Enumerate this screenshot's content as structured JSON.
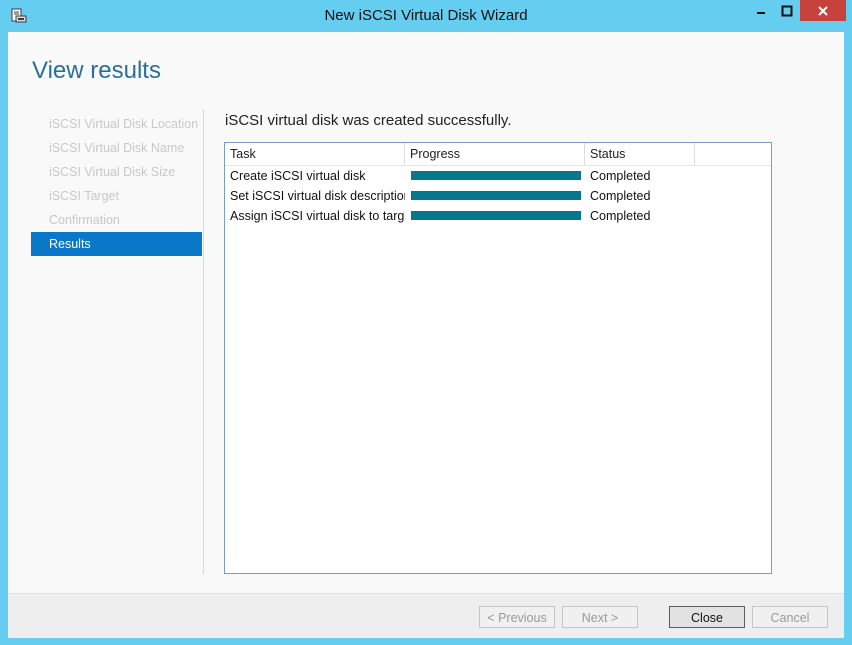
{
  "window": {
    "title": "New iSCSI Virtual Disk Wizard",
    "accent": "#65cdef",
    "close_color": "#c7423c",
    "icon": "app-icon"
  },
  "page": {
    "heading": "View results",
    "message": "iSCSI virtual disk was created successfully."
  },
  "nav": {
    "items": [
      {
        "label": "iSCSI Virtual Disk Location"
      },
      {
        "label": "iSCSI Virtual Disk Name"
      },
      {
        "label": "iSCSI Virtual Disk Size"
      },
      {
        "label": "iSCSI Target"
      },
      {
        "label": "Confirmation"
      },
      {
        "label": "Results"
      }
    ],
    "active_index": 5,
    "active_color": "#0a78c8"
  },
  "results": {
    "columns": [
      "Task",
      "Progress",
      "Status"
    ],
    "rows": [
      {
        "task": "Create iSCSI virtual disk",
        "progress": 100,
        "status": "Completed"
      },
      {
        "task": "Set iSCSI virtual disk description",
        "progress": 100,
        "status": "Completed"
      },
      {
        "task": "Assign iSCSI virtual disk to target",
        "progress": 100,
        "status": "Completed"
      }
    ],
    "progress_color": "#05788e"
  },
  "buttons": {
    "previous": "< Previous",
    "next": "Next >",
    "close": "Close",
    "cancel": "Cancel"
  }
}
